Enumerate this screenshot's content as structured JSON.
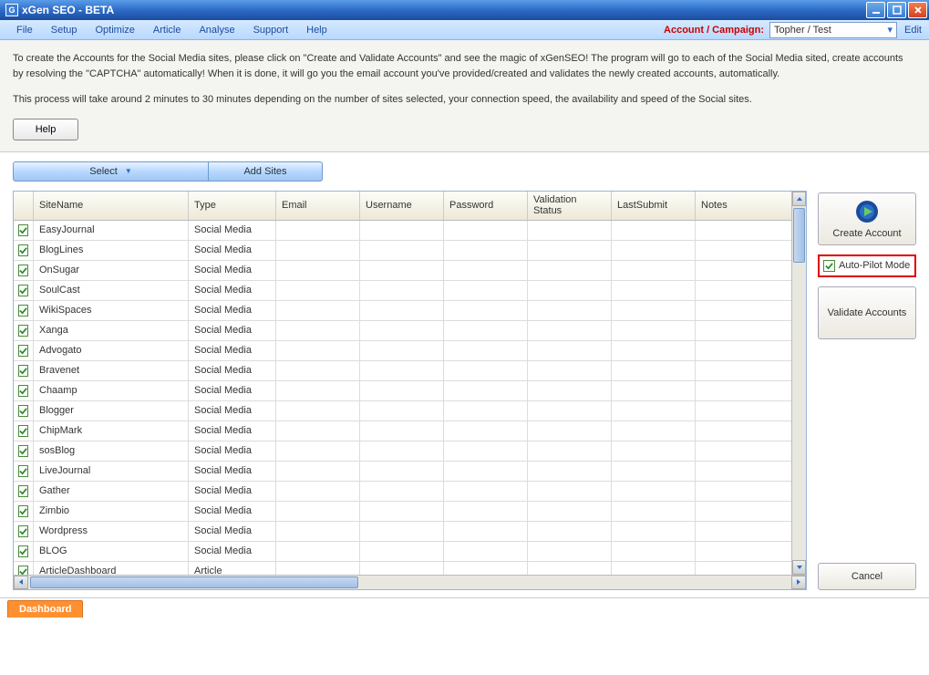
{
  "titlebar": {
    "app_letter": "G",
    "title": "xGen SEO - BETA"
  },
  "menu": {
    "items": [
      "File",
      "Setup",
      "Optimize",
      "Article",
      "Analyse",
      "Support",
      "Help"
    ],
    "account_label": "Account / Campaign:",
    "account_value": "Topher / Test",
    "edit": "Edit"
  },
  "description": {
    "p1": "To create the Accounts for the Social Media sites, please click on \"Create and Validate Accounts\" and see the magic of xGenSEO! The program will go to each of the Social Media sited, create accounts by resolving the \"CAPTCHA\" automatically! When it is done, it will go you the email account you've provided/created and validates the newly created accounts, automatically.",
    "p2": "This process will take around 2 minutes to 30 minutes depending on the number of sites selected, your connection speed, the availability and speed of the Social sites."
  },
  "buttons": {
    "help": "Help",
    "select": "Select",
    "add_sites": "Add Sites",
    "create_account": "Create Account",
    "validate_accounts": "Validate Accounts",
    "cancel": "Cancel",
    "autopilot": "Auto-Pilot Mode"
  },
  "grid": {
    "headers": {
      "site": "SiteName",
      "type": "Type",
      "email": "Email",
      "user": "Username",
      "pass": "Password",
      "valid": "Validation Status",
      "last": "LastSubmit",
      "notes": "Notes"
    },
    "rows": [
      {
        "site": "EasyJournal",
        "type": "Social Media"
      },
      {
        "site": "BlogLines",
        "type": "Social Media"
      },
      {
        "site": "OnSugar",
        "type": "Social Media"
      },
      {
        "site": "SoulCast",
        "type": "Social Media"
      },
      {
        "site": "WikiSpaces",
        "type": "Social Media"
      },
      {
        "site": "Xanga",
        "type": "Social Media"
      },
      {
        "site": "Advogato",
        "type": "Social Media"
      },
      {
        "site": "Bravenet",
        "type": "Social Media"
      },
      {
        "site": "Chaamp",
        "type": "Social Media"
      },
      {
        "site": "Blogger",
        "type": "Social Media"
      },
      {
        "site": "ChipMark",
        "type": "Social Media"
      },
      {
        "site": "sosBlog",
        "type": "Social Media"
      },
      {
        "site": "LiveJournal",
        "type": "Social Media"
      },
      {
        "site": "Gather",
        "type": "Social Media"
      },
      {
        "site": "Zimbio",
        "type": "Social Media"
      },
      {
        "site": "Wordpress",
        "type": "Social Media"
      },
      {
        "site": "BLOG",
        "type": "Social Media"
      },
      {
        "site": "ArticleDashboard",
        "type": "Article"
      }
    ]
  },
  "footer": {
    "dashboard": "Dashboard"
  }
}
